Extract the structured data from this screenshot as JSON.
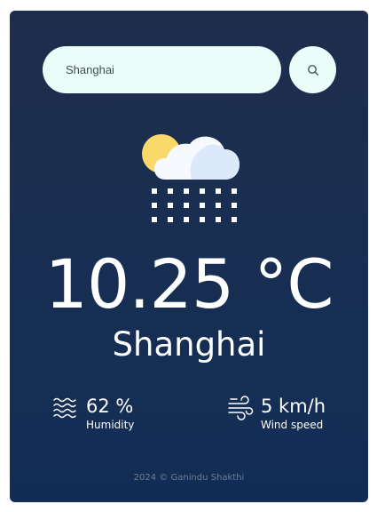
{
  "search": {
    "value": "Shanghai",
    "icon": "search-icon"
  },
  "weather": {
    "condition_icon": "cloud-snow-icon",
    "temperature": "10.25 °C",
    "city": "Shanghai"
  },
  "details": {
    "humidity": {
      "value": "62 %",
      "label": "Humidity",
      "icon": "humidity-waves-icon"
    },
    "wind": {
      "value": "5 km/h",
      "label": "Wind speed",
      "icon": "wind-icon"
    }
  },
  "footer": {
    "text": "2024 © Ganindu Shakthi"
  },
  "colors": {
    "card_top": "#1e2d4c",
    "card_bottom": "#122d55",
    "field_background": "#eafdf8",
    "sun": "#f8d96a",
    "cloud": "#dbe9fb",
    "snow": "#ffffff"
  }
}
